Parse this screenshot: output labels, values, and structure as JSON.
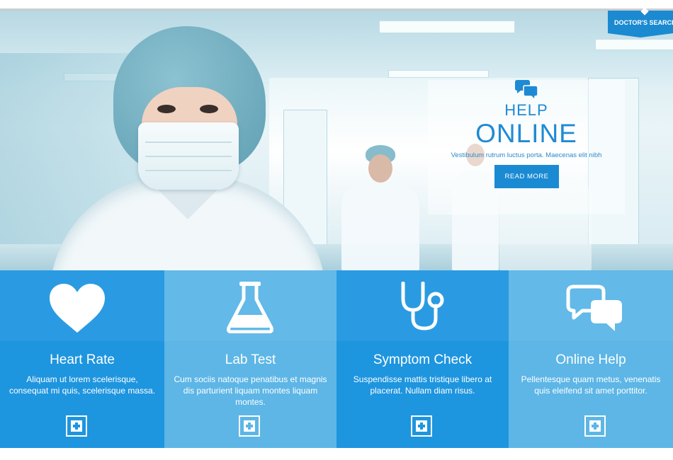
{
  "hero": {
    "help_small": "HELP",
    "help_big": "ONLINE",
    "subtitle": "Vestibulum rutrum luctus porta. Maecenas elit nibh",
    "read_more": "READ MORE"
  },
  "doctor_tab": {
    "label": "DOCTOR'S SEARCH"
  },
  "colors": {
    "accent": "#1a8ad3",
    "tile_dark": "#1e95df",
    "tile_light": "#5db6e6"
  },
  "features": [
    {
      "title": "Heart Rate",
      "text": "Aliquam ut lorem scelerisque, consequat mi quis, scelerisque massa.",
      "icon": "heart-icon"
    },
    {
      "title": "Lab Test",
      "text": "Cum sociis natoque penatibus et magnis dis parturient liquam montes liquam montes.",
      "icon": "flask-icon"
    },
    {
      "title": "Symptom Check",
      "text": "Suspendisse mattis tristique libero at placerat. Nullam diam risus.",
      "icon": "stethoscope-icon"
    },
    {
      "title": "Online Help",
      "text": "Pellentesque quam metus, venenatis quis eleifend sit amet porttitor.",
      "icon": "chat-bubbles-icon"
    }
  ]
}
